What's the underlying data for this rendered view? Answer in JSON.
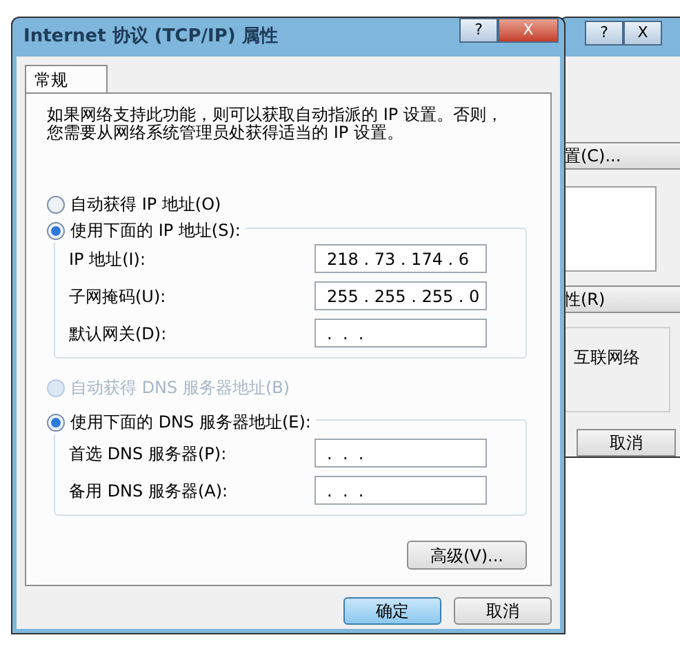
{
  "back_window": {
    "title_buttons": [
      "?",
      "X"
    ],
    "buttons": [
      {
        "label": "置(C)..."
      },
      {
        "label": "性(R)"
      }
    ],
    "description": "互联网络",
    "cancel": "取消"
  },
  "dialog": {
    "title": "Internet 协议 (TCP/IP) 属性",
    "title_buttons": [
      "?",
      "X"
    ],
    "tabs": [
      {
        "label": "常规",
        "selected": true
      }
    ],
    "intro": "如果网络支持此功能，则可以获取自动指派的 IP 设置。否则，您需要从网络系统管理员处获得适当的 IP 设置。",
    "ip_auto": {
      "label": "自动获得 IP 地址(O)",
      "selected": false,
      "disabled": false
    },
    "ip_manual": {
      "label": "使用下面的 IP 地址(S):",
      "selected": true,
      "disabled": false
    },
    "ip_fields": [
      {
        "label": "IP 地址(I):",
        "value": "218 . 73 . 174 . 6"
      },
      {
        "label": "子网掩码(U):",
        "value": "255 . 255 . 255 . 0"
      },
      {
        "label": "默认网关(D):",
        "value": ".  .  ."
      }
    ],
    "dns_auto": {
      "label": "自动获得 DNS 服务器地址(B)",
      "selected": false,
      "disabled": true
    },
    "dns_manual": {
      "label": "使用下面的 DNS 服务器地址(E):",
      "selected": true,
      "disabled": false
    },
    "dns_fields": [
      {
        "label": "首选 DNS 服务器(P):",
        "value": ".  .  ."
      },
      {
        "label": "备用 DNS 服务器(A):",
        "value": ".  .  ."
      }
    ],
    "advanced": "高级(V)...",
    "buttons": [
      {
        "label": "确定",
        "default": true
      },
      {
        "label": "取消",
        "default": false
      }
    ]
  }
}
